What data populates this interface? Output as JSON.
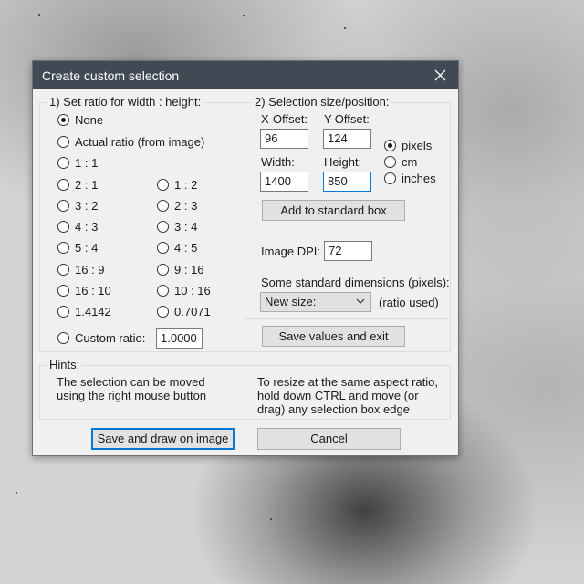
{
  "window": {
    "title": "Create custom selection"
  },
  "ratio_group": {
    "label": "1) Set ratio for width : height:",
    "options": {
      "none": "None",
      "actual": "Actual ratio (from image)",
      "r1_1": "1 : 1",
      "r2_1": "2 : 1",
      "r1_2": "1 : 2",
      "r3_2": "3 : 2",
      "r2_3": "2 : 3",
      "r4_3": "4 : 3",
      "r3_4": "3 : 4",
      "r5_4": "5 : 4",
      "r4_5": "4 : 5",
      "r16_9": "16 : 9",
      "r9_16": "9 : 16",
      "r16_10": "16 : 10",
      "r10_16": "10 : 16",
      "r14142": "1.4142",
      "r07071": "0.7071",
      "custom": "Custom ratio:"
    },
    "selected": "None",
    "custom_value": "1.0000"
  },
  "size_group": {
    "label": "2) Selection size/position:",
    "x_offset_label": "X-Offset:",
    "x_offset": "96",
    "y_offset_label": "Y-Offset:",
    "y_offset": "124",
    "width_label": "Width:",
    "width": "1400",
    "height_label": "Height:",
    "height": "850",
    "units": {
      "pixels": "pixels",
      "cm": "cm",
      "inches": "inches"
    },
    "selected_unit": "pixels",
    "add_button": "Add to standard box",
    "dpi_label": "Image DPI:",
    "dpi": "72",
    "std_dims_label": "Some standard dimensions (pixels):",
    "std_dims_value": "New size:",
    "ratio_used": "(ratio used)",
    "save_exit_button": "Save values and exit"
  },
  "hints": {
    "label": "Hints:",
    "left": [
      "The selection can be moved",
      "using the right mouse button"
    ],
    "right": [
      "To resize at the same aspect ratio,",
      "hold down CTRL and move (or",
      "drag) any selection box edge"
    ]
  },
  "footer": {
    "save_draw_button": "Save and draw on image",
    "cancel_button": "Cancel"
  }
}
